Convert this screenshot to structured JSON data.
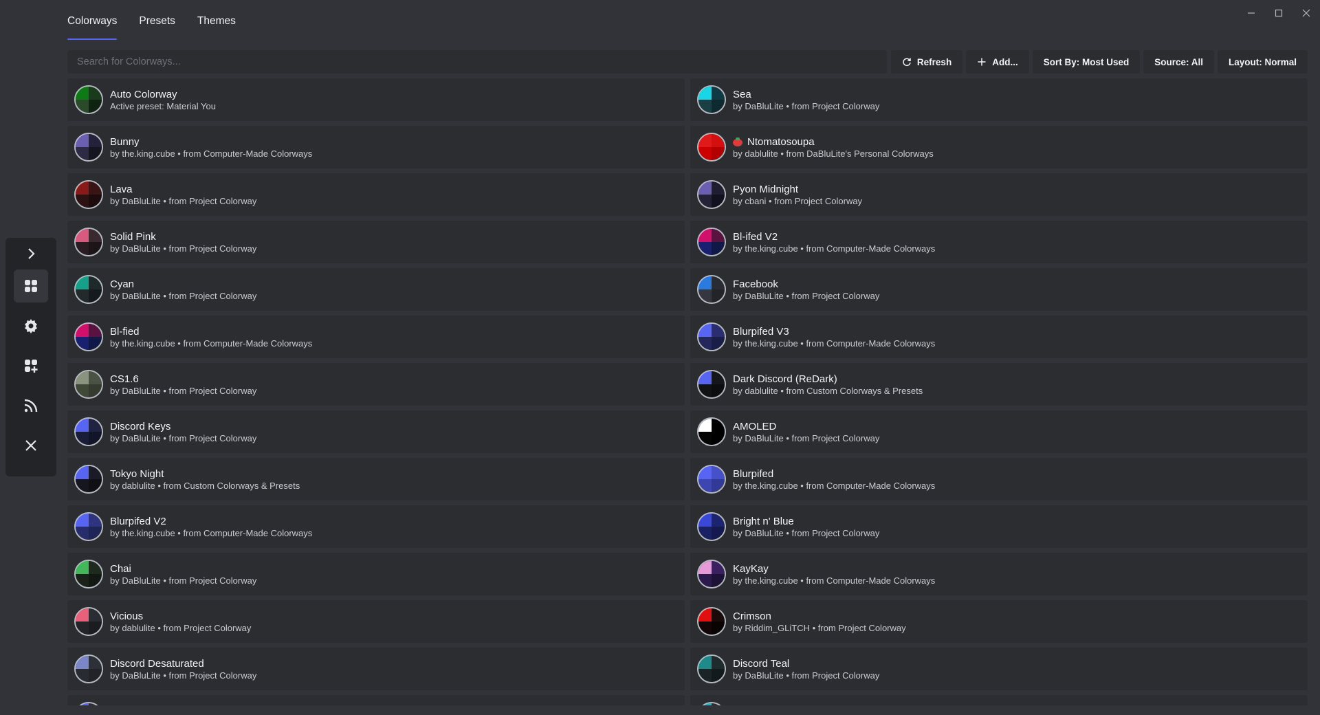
{
  "tabs": [
    {
      "label": "Colorways",
      "active": true
    },
    {
      "label": "Presets",
      "active": false
    },
    {
      "label": "Themes",
      "active": false
    }
  ],
  "search": {
    "placeholder": "Search for Colorways..."
  },
  "toolbar": {
    "refresh": "Refresh",
    "add": "Add...",
    "sort": "Sort By: Most Used",
    "source": "Source: All",
    "layout": "Layout: Normal"
  },
  "sidebar": {
    "icons": [
      "chevron-right-icon",
      "grid-icon",
      "gear-icon",
      "add-grid-icon",
      "rss-icon",
      "close-icon"
    ]
  },
  "colorways": [
    {
      "name": "Auto Colorway",
      "sub": "Active preset: Material You",
      "colors": [
        "#0e7a16",
        "#1a3a1c",
        "#2a4a2a",
        "#0f2410"
      ]
    },
    {
      "name": "Sea",
      "sub": "by DaBluLite • from Project Colorway",
      "colors": [
        "#19d6e6",
        "#0f3a44",
        "#1a3f45",
        "#0c2a30"
      ]
    },
    {
      "name": "Bunny",
      "sub": "by the.king.cube • from Computer-Made Colorways",
      "colors": [
        "#6a5fb0",
        "#24223a",
        "#2c2a44",
        "#15141f"
      ]
    },
    {
      "name": "Ntomatosoupa",
      "sub": "by dablulite • from DaBluLite's Personal Colorways",
      "colors": [
        "#e01a1a",
        "#d40f0f",
        "#c00",
        "#b30000"
      ],
      "emoji": true
    },
    {
      "name": "Lava",
      "sub": "by DaBluLite • from Project Colorway",
      "colors": [
        "#8a1a1a",
        "#3a1414",
        "#2c1212",
        "#1e0c0c"
      ]
    },
    {
      "name": "Pyon Midnight",
      "sub": "by cbani • from Project Colorway",
      "colors": [
        "#6a5fb0",
        "#1f1d30",
        "#232236",
        "#121120"
      ]
    },
    {
      "name": "Solid Pink",
      "sub": "by DaBluLite • from Project Colorway",
      "colors": [
        "#d85a7f",
        "#3a2a30",
        "#2a1d22",
        "#1d1418"
      ]
    },
    {
      "name": "Bl-ifed V2",
      "sub": "by the.king.cube • from Computer-Made Colorways",
      "colors": [
        "#d0106a",
        "#5a1240",
        "#1a2070",
        "#101848"
      ]
    },
    {
      "name": "Cyan",
      "sub": "by DaBluLite • from Project Colorway",
      "colors": [
        "#15a08a",
        "#1e2a2a",
        "#232a2c",
        "#151a1c"
      ]
    },
    {
      "name": "Facebook",
      "sub": "by DaBluLite • from Project Colorway",
      "colors": [
        "#2a7ae0",
        "#2a2c33",
        "#353740",
        "#232428"
      ]
    },
    {
      "name": "Bl-fied",
      "sub": "by the.king.cube • from Computer-Made Colorways",
      "colors": [
        "#d0106a",
        "#5a1240",
        "#1a2070",
        "#101848"
      ]
    },
    {
      "name": "Blurpifed V3",
      "sub": "by the.king.cube • from Computer-Made Colorways",
      "colors": [
        "#5865f2",
        "#2a2e70",
        "#23275c",
        "#1a1d48"
      ]
    },
    {
      "name": "CS1.6",
      "sub": "by DaBluLite • from Project Colorway",
      "colors": [
        "#8a9280",
        "#4a5244",
        "#404838",
        "#353c2f"
      ]
    },
    {
      "name": "Dark Discord (ReDark)",
      "sub": "by dablulite • from Custom Colorways & Presets",
      "colors": [
        "#5865f2",
        "#15161a",
        "#111214",
        "#0c0d0f"
      ]
    },
    {
      "name": "Discord Keys",
      "sub": "by DaBluLite • from Project Colorway",
      "colors": [
        "#5865f2",
        "#1f2240",
        "#1a1d38",
        "#12142a"
      ]
    },
    {
      "name": "AMOLED",
      "sub": "by DaBluLite • from Project Colorway",
      "colors": [
        "#ffffff",
        "#000000",
        "#050505",
        "#000000"
      ]
    },
    {
      "name": "Tokyo Night",
      "sub": "by dablulite • from Custom Colorways & Presets",
      "colors": [
        "#5865f2",
        "#1a1b26",
        "#16161e",
        "#101014"
      ]
    },
    {
      "name": "Blurpifed",
      "sub": "by the.king.cube • from Computer-Made Colorways",
      "colors": [
        "#5865f2",
        "#4650c8",
        "#3c45b0",
        "#323a98"
      ]
    },
    {
      "name": "Blurpifed V2",
      "sub": "by the.king.cube • from Computer-Made Colorways",
      "colors": [
        "#5865f2",
        "#2e3480",
        "#262c6c",
        "#1e2358"
      ]
    },
    {
      "name": "Bright n' Blue",
      "sub": "by DaBluLite • from Project Colorway",
      "colors": [
        "#3a48d8",
        "#1c2470",
        "#1a2064",
        "#141a50"
      ]
    },
    {
      "name": "Chai",
      "sub": "by DaBluLite • from Project Colorway",
      "colors": [
        "#43b85a",
        "#1e2a1e",
        "#1a221a",
        "#121812"
      ]
    },
    {
      "name": "KayKay",
      "sub": "by the.king.cube • from Computer-Made Colorways",
      "colors": [
        "#e89ad8",
        "#3a2060",
        "#2c1a4c",
        "#1e1238"
      ]
    },
    {
      "name": "Vicious",
      "sub": "by dablulite • from Project Colorway",
      "colors": [
        "#e8607a",
        "#2a2c33",
        "#232428",
        "#1b1c20"
      ]
    },
    {
      "name": "Crimson",
      "sub": "by Riddim_GLiTCH • from Project Colorway",
      "colors": [
        "#e01010",
        "#1a0a0a",
        "#120606",
        "#0a0303"
      ]
    },
    {
      "name": "Discord Desaturated",
      "sub": "by DaBluLite • from Project Colorway",
      "colors": [
        "#7a86c8",
        "#2e3038",
        "#292b32",
        "#222328"
      ]
    },
    {
      "name": "Discord Teal",
      "sub": "by DaBluLite • from Project Colorway",
      "colors": [
        "#1f8a8a",
        "#1e2a2c",
        "#1a2426",
        "#131a1c"
      ]
    },
    {
      "name": "",
      "sub": "",
      "colors": [
        "#5865f2",
        "#2b2d31",
        "#2b2d31",
        "#2b2d31"
      ]
    },
    {
      "name": "",
      "sub": "",
      "colors": [
        "#19b6c6",
        "#2b2d31",
        "#2b2d31",
        "#2b2d31"
      ]
    }
  ]
}
